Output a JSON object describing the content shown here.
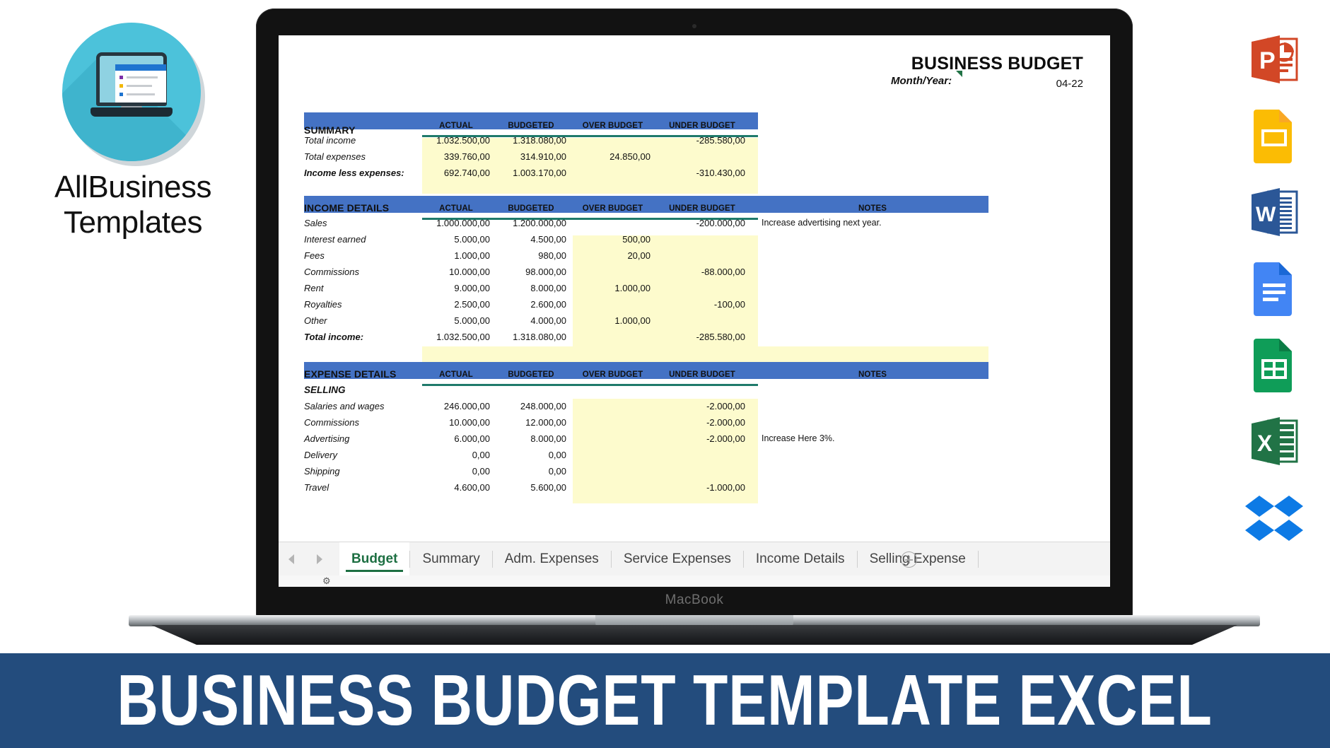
{
  "brand": {
    "name_line1": "AllBusiness",
    "name_line2": "Templates",
    "logo_icon": "laptop-checklist-icon",
    "circle_color": "#4cc2da"
  },
  "device": {
    "label": "MacBook"
  },
  "banner": {
    "text": "BUSINESS BUDGET TEMPLATE EXCEL",
    "bg_color": "#234c7d"
  },
  "spreadsheet": {
    "title": "BUSINESS BUDGET",
    "date": "04-22",
    "month_year_label": "Month/Year:",
    "accent_blue": "#4472c4",
    "rule_teal": "#1f7a6b",
    "highlight_yellow": "#fdfbcd",
    "columns": [
      "ACTUAL",
      "BUDGETED",
      "OVER BUDGET",
      "UNDER BUDGET",
      "NOTES"
    ],
    "summary": {
      "header": "SUMMARY",
      "rows": [
        {
          "label": "Total income",
          "actual": "1.032.500,00",
          "budgeted": "1.318.080,00",
          "over": "",
          "under": "-285.580,00",
          "notes": "",
          "bold": false
        },
        {
          "label": "Total expenses",
          "actual": "339.760,00",
          "budgeted": "314.910,00",
          "over": "24.850,00",
          "under": "",
          "notes": "",
          "bold": false
        },
        {
          "label": "Income less expenses:",
          "actual": "692.740,00",
          "budgeted": "1.003.170,00",
          "over": "",
          "under": "-310.430,00",
          "notes": "",
          "bold": true
        }
      ]
    },
    "income_details": {
      "header": "INCOME DETAILS",
      "rows": [
        {
          "label": "Sales",
          "actual": "1.000.000,00",
          "budgeted": "1.200.000,00",
          "over": "",
          "under": "-200.000,00",
          "notes": "Increase advertising next year.",
          "bold": false
        },
        {
          "label": "Interest earned",
          "actual": "5.000,00",
          "budgeted": "4.500,00",
          "over": "500,00",
          "under": "",
          "notes": "",
          "bold": false
        },
        {
          "label": "Fees",
          "actual": "1.000,00",
          "budgeted": "980,00",
          "over": "20,00",
          "under": "",
          "notes": "",
          "bold": false
        },
        {
          "label": "Commissions",
          "actual": "10.000,00",
          "budgeted": "98.000,00",
          "over": "",
          "under": "-88.000,00",
          "notes": "",
          "bold": false
        },
        {
          "label": "Rent",
          "actual": "9.000,00",
          "budgeted": "8.000,00",
          "over": "1.000,00",
          "under": "",
          "notes": "",
          "bold": false
        },
        {
          "label": "Royalties",
          "actual": "2.500,00",
          "budgeted": "2.600,00",
          "over": "",
          "under": "-100,00",
          "notes": "",
          "bold": false
        },
        {
          "label": "Other",
          "actual": "5.000,00",
          "budgeted": "4.000,00",
          "over": "1.000,00",
          "under": "",
          "notes": "",
          "bold": false
        },
        {
          "label": "Total income:",
          "actual": "1.032.500,00",
          "budgeted": "1.318.080,00",
          "over": "",
          "under": "-285.580,00",
          "notes": "",
          "bold": true
        }
      ]
    },
    "expense_details": {
      "header": "EXPENSE DETAILS",
      "subheader": "SELLING",
      "rows": [
        {
          "label": "Salaries and wages",
          "actual": "246.000,00",
          "budgeted": "248.000,00",
          "over": "",
          "under": "-2.000,00",
          "notes": "",
          "bold": false
        },
        {
          "label": "Commissions",
          "actual": "10.000,00",
          "budgeted": "12.000,00",
          "over": "",
          "under": "-2.000,00",
          "notes": "",
          "bold": false
        },
        {
          "label": "Advertising",
          "actual": "6.000,00",
          "budgeted": "8.000,00",
          "over": "",
          "under": "-2.000,00",
          "notes": "Increase Here 3%.",
          "bold": false
        },
        {
          "label": "Delivery",
          "actual": "0,00",
          "budgeted": "0,00",
          "over": "",
          "under": "",
          "notes": "",
          "bold": false
        },
        {
          "label": "Shipping",
          "actual": "0,00",
          "budgeted": "0,00",
          "over": "",
          "under": "",
          "notes": "",
          "bold": false
        },
        {
          "label": "Travel",
          "actual": "4.600,00",
          "budgeted": "5.600,00",
          "over": "",
          "under": "-1.000,00",
          "notes": "",
          "bold": false
        }
      ]
    },
    "sheet_tabs": [
      {
        "label": "Budget",
        "active": true
      },
      {
        "label": "Summary",
        "active": false
      },
      {
        "label": "Adm. Expenses",
        "active": false
      },
      {
        "label": "Service Expenses",
        "active": false
      },
      {
        "label": "Income Details",
        "active": false
      },
      {
        "label": "Selling Expense",
        "active": false
      }
    ],
    "add_sheet_icon": "plus-circle-icon",
    "prev_sheet_icon": "chevron-left-icon",
    "next_sheet_icon": "chevron-right-icon"
  },
  "app_rail": [
    {
      "name": "powerpoint-icon",
      "label": "PowerPoint",
      "color": "#d24726"
    },
    {
      "name": "google-slides-icon",
      "label": "Google Slides",
      "color": "#fbbc04"
    },
    {
      "name": "word-icon",
      "label": "Word",
      "color": "#2b5797"
    },
    {
      "name": "google-docs-icon",
      "label": "Google Docs",
      "color": "#4285f4"
    },
    {
      "name": "google-sheets-icon",
      "label": "Google Sheets",
      "color": "#0f9d58"
    },
    {
      "name": "excel-icon",
      "label": "Excel",
      "color": "#217346"
    },
    {
      "name": "dropbox-icon",
      "label": "Dropbox",
      "color": "#0d7ae5"
    }
  ]
}
